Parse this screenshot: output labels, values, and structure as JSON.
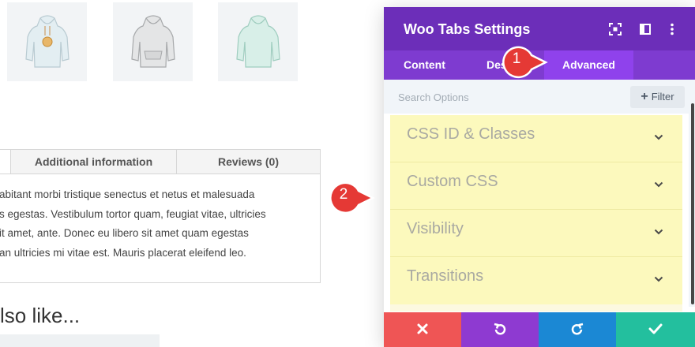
{
  "woo_tabs": {
    "tabs": [
      "Additional information",
      "Reviews (0)"
    ],
    "text_lines": [
      "abitant morbi tristique senectus et netus et malesuada",
      "s egestas. Vestibulum tortor quam, feugiat vitae, ultricies",
      "it amet, ante. Donec eu libero sit amet quam egestas",
      "an ultricies mi vitae est. Mauris placerat eleifend leo."
    ]
  },
  "related": {
    "heading": "lso like..."
  },
  "modal": {
    "title": "Woo Tabs Settings",
    "tabs": {
      "content": "Content",
      "design": "Des",
      "advanced": "Advanced"
    },
    "search": {
      "placeholder": "Search Options",
      "filter_label": "Filter"
    },
    "options": [
      "CSS ID & Classes",
      "Custom CSS",
      "Visibility",
      "Transitions"
    ],
    "colors": {
      "header": "#6c2eb9",
      "tabs": "#7e3bd0",
      "active_tab": "#8f42ec",
      "highlight": "#fcf9bd",
      "discard": "#ef5555",
      "undo": "#8e3ad1",
      "redo": "#1b88d4",
      "save": "#23bf9e"
    },
    "footer_icons": [
      "close-icon",
      "undo-icon",
      "redo-icon",
      "check-icon"
    ]
  },
  "annotations": {
    "marker_1": "1",
    "marker_2": "2",
    "marker_color": "#e53935"
  }
}
